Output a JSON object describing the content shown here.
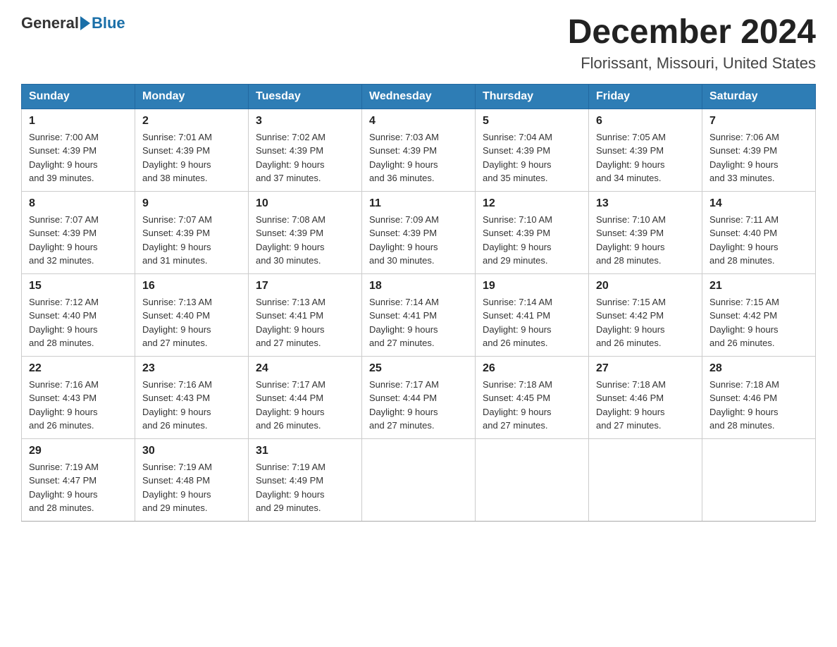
{
  "header": {
    "logo_general": "General",
    "logo_blue": "Blue",
    "main_title": "December 2024",
    "subtitle": "Florissant, Missouri, United States"
  },
  "days_of_week": [
    "Sunday",
    "Monday",
    "Tuesday",
    "Wednesday",
    "Thursday",
    "Friday",
    "Saturday"
  ],
  "weeks": [
    [
      {
        "num": "1",
        "sunrise": "7:00 AM",
        "sunset": "4:39 PM",
        "daylight": "9 hours and 39 minutes."
      },
      {
        "num": "2",
        "sunrise": "7:01 AM",
        "sunset": "4:39 PM",
        "daylight": "9 hours and 38 minutes."
      },
      {
        "num": "3",
        "sunrise": "7:02 AM",
        "sunset": "4:39 PM",
        "daylight": "9 hours and 37 minutes."
      },
      {
        "num": "4",
        "sunrise": "7:03 AM",
        "sunset": "4:39 PM",
        "daylight": "9 hours and 36 minutes."
      },
      {
        "num": "5",
        "sunrise": "7:04 AM",
        "sunset": "4:39 PM",
        "daylight": "9 hours and 35 minutes."
      },
      {
        "num": "6",
        "sunrise": "7:05 AM",
        "sunset": "4:39 PM",
        "daylight": "9 hours and 34 minutes."
      },
      {
        "num": "7",
        "sunrise": "7:06 AM",
        "sunset": "4:39 PM",
        "daylight": "9 hours and 33 minutes."
      }
    ],
    [
      {
        "num": "8",
        "sunrise": "7:07 AM",
        "sunset": "4:39 PM",
        "daylight": "9 hours and 32 minutes."
      },
      {
        "num": "9",
        "sunrise": "7:07 AM",
        "sunset": "4:39 PM",
        "daylight": "9 hours and 31 minutes."
      },
      {
        "num": "10",
        "sunrise": "7:08 AM",
        "sunset": "4:39 PM",
        "daylight": "9 hours and 30 minutes."
      },
      {
        "num": "11",
        "sunrise": "7:09 AM",
        "sunset": "4:39 PM",
        "daylight": "9 hours and 30 minutes."
      },
      {
        "num": "12",
        "sunrise": "7:10 AM",
        "sunset": "4:39 PM",
        "daylight": "9 hours and 29 minutes."
      },
      {
        "num": "13",
        "sunrise": "7:10 AM",
        "sunset": "4:39 PM",
        "daylight": "9 hours and 28 minutes."
      },
      {
        "num": "14",
        "sunrise": "7:11 AM",
        "sunset": "4:40 PM",
        "daylight": "9 hours and 28 minutes."
      }
    ],
    [
      {
        "num": "15",
        "sunrise": "7:12 AM",
        "sunset": "4:40 PM",
        "daylight": "9 hours and 28 minutes."
      },
      {
        "num": "16",
        "sunrise": "7:13 AM",
        "sunset": "4:40 PM",
        "daylight": "9 hours and 27 minutes."
      },
      {
        "num": "17",
        "sunrise": "7:13 AM",
        "sunset": "4:41 PM",
        "daylight": "9 hours and 27 minutes."
      },
      {
        "num": "18",
        "sunrise": "7:14 AM",
        "sunset": "4:41 PM",
        "daylight": "9 hours and 27 minutes."
      },
      {
        "num": "19",
        "sunrise": "7:14 AM",
        "sunset": "4:41 PM",
        "daylight": "9 hours and 26 minutes."
      },
      {
        "num": "20",
        "sunrise": "7:15 AM",
        "sunset": "4:42 PM",
        "daylight": "9 hours and 26 minutes."
      },
      {
        "num": "21",
        "sunrise": "7:15 AM",
        "sunset": "4:42 PM",
        "daylight": "9 hours and 26 minutes."
      }
    ],
    [
      {
        "num": "22",
        "sunrise": "7:16 AM",
        "sunset": "4:43 PM",
        "daylight": "9 hours and 26 minutes."
      },
      {
        "num": "23",
        "sunrise": "7:16 AM",
        "sunset": "4:43 PM",
        "daylight": "9 hours and 26 minutes."
      },
      {
        "num": "24",
        "sunrise": "7:17 AM",
        "sunset": "4:44 PM",
        "daylight": "9 hours and 26 minutes."
      },
      {
        "num": "25",
        "sunrise": "7:17 AM",
        "sunset": "4:44 PM",
        "daylight": "9 hours and 27 minutes."
      },
      {
        "num": "26",
        "sunrise": "7:18 AM",
        "sunset": "4:45 PM",
        "daylight": "9 hours and 27 minutes."
      },
      {
        "num": "27",
        "sunrise": "7:18 AM",
        "sunset": "4:46 PM",
        "daylight": "9 hours and 27 minutes."
      },
      {
        "num": "28",
        "sunrise": "7:18 AM",
        "sunset": "4:46 PM",
        "daylight": "9 hours and 28 minutes."
      }
    ],
    [
      {
        "num": "29",
        "sunrise": "7:19 AM",
        "sunset": "4:47 PM",
        "daylight": "9 hours and 28 minutes."
      },
      {
        "num": "30",
        "sunrise": "7:19 AM",
        "sunset": "4:48 PM",
        "daylight": "9 hours and 29 minutes."
      },
      {
        "num": "31",
        "sunrise": "7:19 AM",
        "sunset": "4:49 PM",
        "daylight": "9 hours and 29 minutes."
      },
      null,
      null,
      null,
      null
    ]
  ],
  "labels": {
    "sunrise": "Sunrise:",
    "sunset": "Sunset:",
    "daylight": "Daylight:"
  }
}
